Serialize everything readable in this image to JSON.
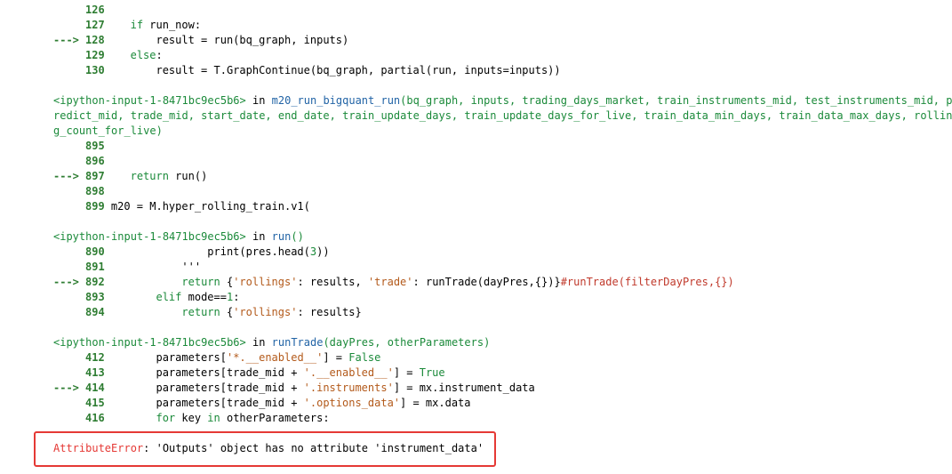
{
  "frames": [
    {
      "lines": [
        {
          "ln": "126",
          "code": ""
        },
        {
          "ln": "127",
          "code": "    if run_now:"
        },
        {
          "ln": "128",
          "code": "        result = run(bq_graph, inputs)",
          "arrow": true
        },
        {
          "ln": "129",
          "code": "    else:"
        },
        {
          "ln": "130",
          "code": "        result = T.GraphContinue(bq_graph, partial(run, inputs=inputs))"
        }
      ]
    }
  ],
  "frame2": {
    "header_input": "<ipython-input-1-8471bc9ec5b6>",
    "header_in": " in ",
    "header_func": "m20_run_bigquant_run",
    "header_args_line1": "(bq_graph, inputs, trading_days_market, train_instruments_mid, test_instruments_mid, p",
    "header_args_line2": "redict_mid, trade_mid, start_date, end_date, train_update_days, train_update_days_for_live, train_data_min_days, train_data_max_days, rollin",
    "header_args_line3": "g_count_for_live)",
    "lines": [
      {
        "ln": "895",
        "code": ""
      },
      {
        "ln": "896",
        "code": ""
      },
      {
        "ln": "897",
        "code": "    return run()",
        "arrow": true
      },
      {
        "ln": "898",
        "code": ""
      },
      {
        "ln": "899",
        "code": "m20 = M.hyper_rolling_train.v1("
      }
    ]
  },
  "frame3": {
    "header_input": "<ipython-input-1-8471bc9ec5b6>",
    "header_in": " in ",
    "header_func": "run",
    "header_args": "()",
    "lines": [
      {
        "ln": "890",
        "code": "                print(pres.head(3))"
      },
      {
        "ln": "891",
        "code": "            '''"
      },
      {
        "ln": "892",
        "code": "            return {'rollings': results, 'trade': runTrade(dayPres,{})}#runTrade(filterDayPres,{})",
        "arrow": true
      },
      {
        "ln": "893",
        "code": "        elif mode==1:"
      },
      {
        "ln": "894",
        "code": "            return {'rollings': results}"
      }
    ]
  },
  "frame4": {
    "header_input": "<ipython-input-1-8471bc9ec5b6>",
    "header_in": " in ",
    "header_func": "runTrade",
    "header_args": "(dayPres, otherParameters)",
    "lines": [
      {
        "ln": "412",
        "code": "        parameters['*.__enabled__'] = False"
      },
      {
        "ln": "413",
        "code": "        parameters[trade_mid + '.__enabled__'] = True"
      },
      {
        "ln": "414",
        "code": "        parameters[trade_mid + '.instruments'] = mx.instrument_data",
        "arrow": true
      },
      {
        "ln": "415",
        "code": "        parameters[trade_mid + '.options_data'] = mx.data"
      },
      {
        "ln": "416",
        "code": "        for key in otherParameters:"
      }
    ]
  },
  "error": {
    "name": "AttributeError",
    "message": ": 'Outputs' object has no attribute 'instrument_data'"
  },
  "arrow_glyph": "--->"
}
